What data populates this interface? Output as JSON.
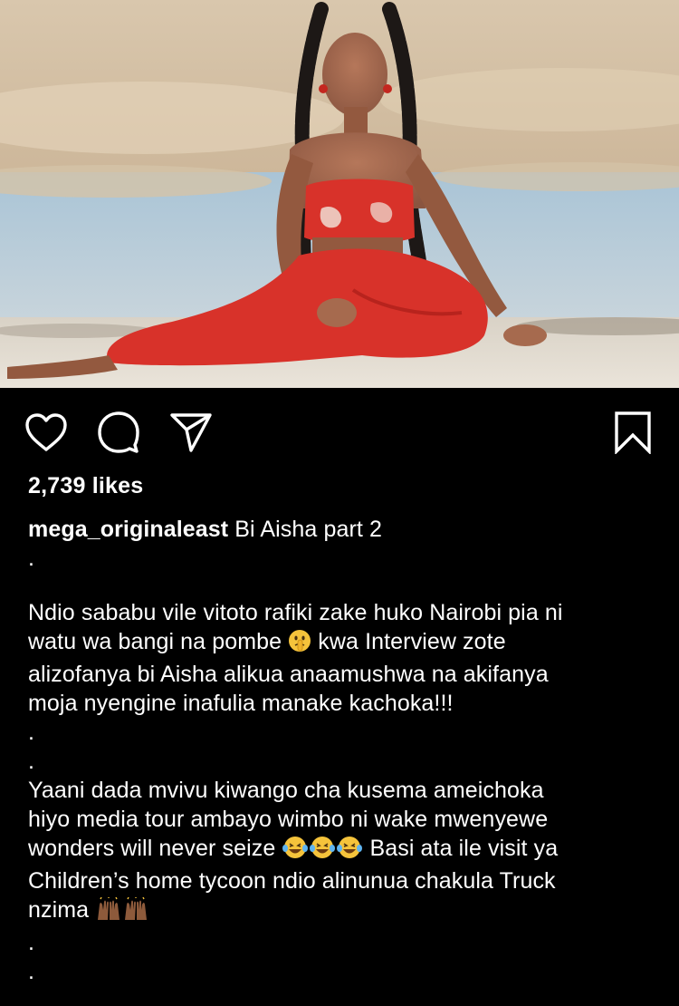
{
  "post": {
    "image_alt": "Woman in red outfit with long braids sitting on sand",
    "icons": {
      "like": "heart-icon",
      "comment": "comment-icon",
      "share": "paper-plane-icon",
      "save": "bookmark-icon"
    },
    "likes_text": "2,739 likes",
    "caption": {
      "username": "mega_originaleast",
      "first_line": " Bi Aisha part 2",
      "dot": ".",
      "paragraph1": [
        "Ndio sababu vile vitoto rafiki zake huko Nairobi pia ni",
        "watu wa bangi na pombe ",
        " kwa Interview zote",
        "alizofanya bi Aisha alikua anaamushwa na akifanya",
        "moja nyengine inafulia manake kachoka!!!"
      ],
      "paragraph2": [
        "Yaani dada mvivu kiwango cha kusema ameichoka",
        "hiyo media tour ambayo wimbo ni wake mwenyewe",
        "wonders will never seize ",
        " Basi ata ile visit ya",
        "Children’s home tycoon ndio alinunua chakula Truck",
        "nzima "
      ],
      "emojis": [
        "shushing-face-emoji",
        "laughing-tears-emoji",
        "raised-hands-emoji"
      ]
    },
    "colors": {
      "background": "#000000",
      "text": "#ffffff",
      "outfit_red": "#d8322a"
    }
  }
}
